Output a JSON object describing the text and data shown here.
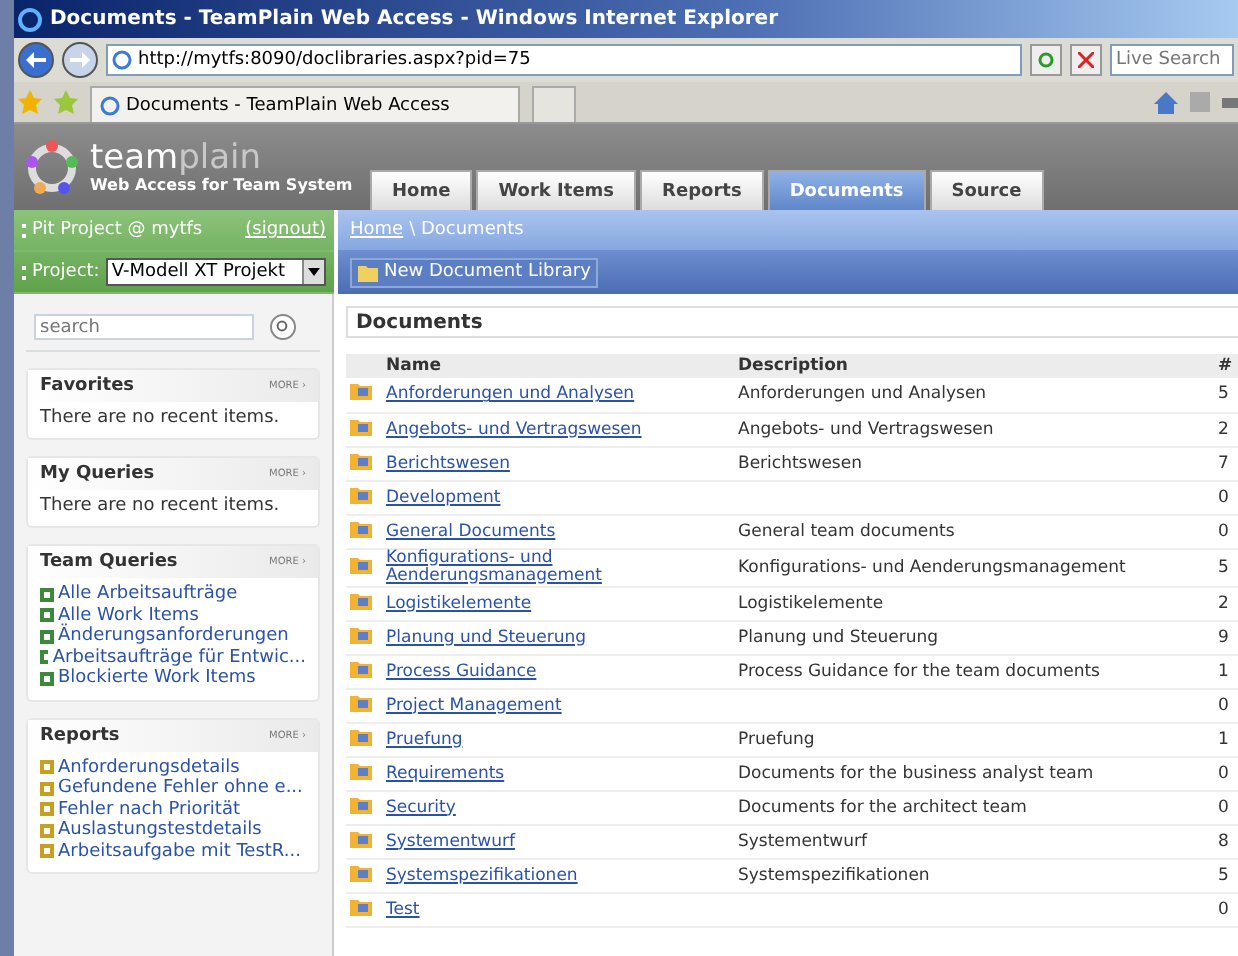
{
  "window": {
    "title": "Documents - TeamPlain Web Access - Windows Internet Explorer"
  },
  "browser": {
    "url": "http://mytfs:8090/doclibraries.aspx?pid=75",
    "search_placeholder": "Live Search",
    "tab_title": "Documents - TeamPlain Web Access"
  },
  "app": {
    "logo_a": "team",
    "logo_b": "plain",
    "subtitle": "Web Access for Team System"
  },
  "nav_tabs": [
    {
      "label": "Home",
      "selected": false
    },
    {
      "label": "Work Items",
      "selected": false
    },
    {
      "label": "Reports",
      "selected": false
    },
    {
      "label": "Documents",
      "selected": true
    },
    {
      "label": "Source",
      "selected": false
    }
  ],
  "user": {
    "text": "Pit Project @ mytfs",
    "signout": "(signout)",
    "project_label": "Project:",
    "project": "V-Modell XT Projekt"
  },
  "breadcrumb": {
    "home": "Home",
    "current": "\\ Documents"
  },
  "toolbar": {
    "button": "New Document Library"
  },
  "sidebar": {
    "search_placeholder": "search",
    "panels": [
      {
        "title": "Favorites",
        "more": "MORE ›",
        "empty": "There are no recent items."
      },
      {
        "title": "My Queries",
        "more": "MORE ›",
        "empty": "There are no recent items."
      },
      {
        "title": "Team Queries",
        "more": "MORE ›",
        "kind": "query",
        "items": [
          "Alle Arbeitsaufträge",
          "Alle Work Items",
          "Änderungsanforderungen",
          "Arbeitsaufträge für Entwic...",
          "Blockierte Work Items"
        ]
      },
      {
        "title": "Reports",
        "more": "MORE ›",
        "kind": "report",
        "items": [
          "Anforderungsdetails",
          "Gefundene Fehler ohne e...",
          "Fehler nach Priorität",
          "Auslastungstestdetails",
          "Arbeitsaufgabe mit TestR..."
        ]
      }
    ]
  },
  "documents": {
    "title": "Documents",
    "columns": [
      "Name",
      "Description",
      "#"
    ],
    "rows": [
      {
        "name": "Anforderungen und Analysen",
        "description": "Anforderungen und Analysen",
        "count": "5"
      },
      {
        "name": "Angebots- und Vertragswesen",
        "description": "Angebots- und Vertragswesen",
        "count": "2"
      },
      {
        "name": "Berichtswesen",
        "description": "Berichtswesen",
        "count": "7"
      },
      {
        "name": "Development",
        "description": "",
        "count": "0"
      },
      {
        "name": "General Documents",
        "description": "General team documents",
        "count": "0"
      },
      {
        "name": "Konfigurations- und Aenderungsmanagement",
        "description": "Konfigurations- und Aenderungsmanagement",
        "count": "5"
      },
      {
        "name": "Logistikelemente",
        "description": "Logistikelemente",
        "count": "2"
      },
      {
        "name": "Planung und Steuerung",
        "description": "Planung und Steuerung",
        "count": "9"
      },
      {
        "name": "Process Guidance",
        "description": "Process Guidance for the team documents",
        "count": "1"
      },
      {
        "name": "Project Management",
        "description": "",
        "count": "0"
      },
      {
        "name": "Pruefung",
        "description": "Pruefung",
        "count": "1"
      },
      {
        "name": "Requirements",
        "description": "Documents for the business analyst team",
        "count": "0"
      },
      {
        "name": "Security",
        "description": "Documents for the architect team",
        "count": "0"
      },
      {
        "name": "Systementwurf",
        "description": "Systementwurf",
        "count": "8"
      },
      {
        "name": "Systemspezifikationen",
        "description": "Systemspezifikationen",
        "count": "5"
      },
      {
        "name": "Test",
        "description": "",
        "count": "0"
      }
    ]
  }
}
